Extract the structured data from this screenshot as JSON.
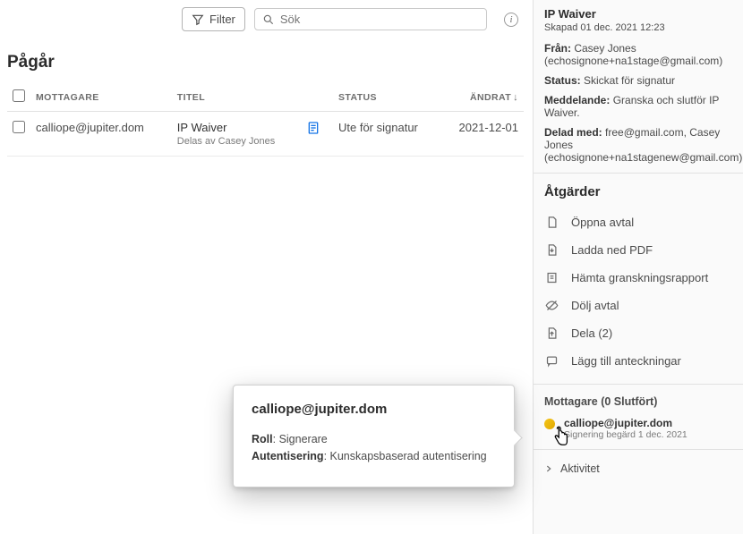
{
  "toolbar": {
    "filter_label": "Filter",
    "search_placeholder": "Sök"
  },
  "section_title": "Pågår",
  "table": {
    "headers": {
      "recipient": "MOTTAGARE",
      "title": "TITEL",
      "status": "STATUS",
      "modified": "ÄNDRAT"
    },
    "row": {
      "recipient": "calliope@jupiter.dom",
      "title": "IP Waiver",
      "shared_by": "Delas av Casey Jones",
      "status": "Ute för signatur",
      "modified": "2021-12-01"
    }
  },
  "tooltip": {
    "email": "calliope@jupiter.dom",
    "role_label": "Roll",
    "role_value": "Signerare",
    "auth_label": "Autentisering",
    "auth_value": "Kunskapsbaserad autentisering"
  },
  "detail": {
    "title": "IP Waiver",
    "created": "Skapad 01 dec. 2021 12:23",
    "from_label": "Från:",
    "from_value": "Casey Jones (echosignone+na1stage@gmail.com)",
    "status_label": "Status:",
    "status_value": "Skickat för signatur",
    "message_label": "Meddelande:",
    "message_value": "Granska och slutför IP Waiver.",
    "shared_label": "Delad med:",
    "shared_value": "free@gmail.com, Casey Jones (echosignone+na1stagenew@gmail.com)"
  },
  "actions": {
    "heading": "Åtgärder",
    "open": "Öppna avtal",
    "download": "Ladda ned PDF",
    "audit": "Hämta granskningsrapport",
    "hide": "Dölj avtal",
    "share": "Dela (2)",
    "notes": "Lägg till anteckningar"
  },
  "recipients": {
    "heading": "Mottagare (0 Slutfört)",
    "email": "calliope@jupiter.dom",
    "date": "Signering begärd 1 dec. 2021"
  },
  "activity_label": "Aktivitet"
}
